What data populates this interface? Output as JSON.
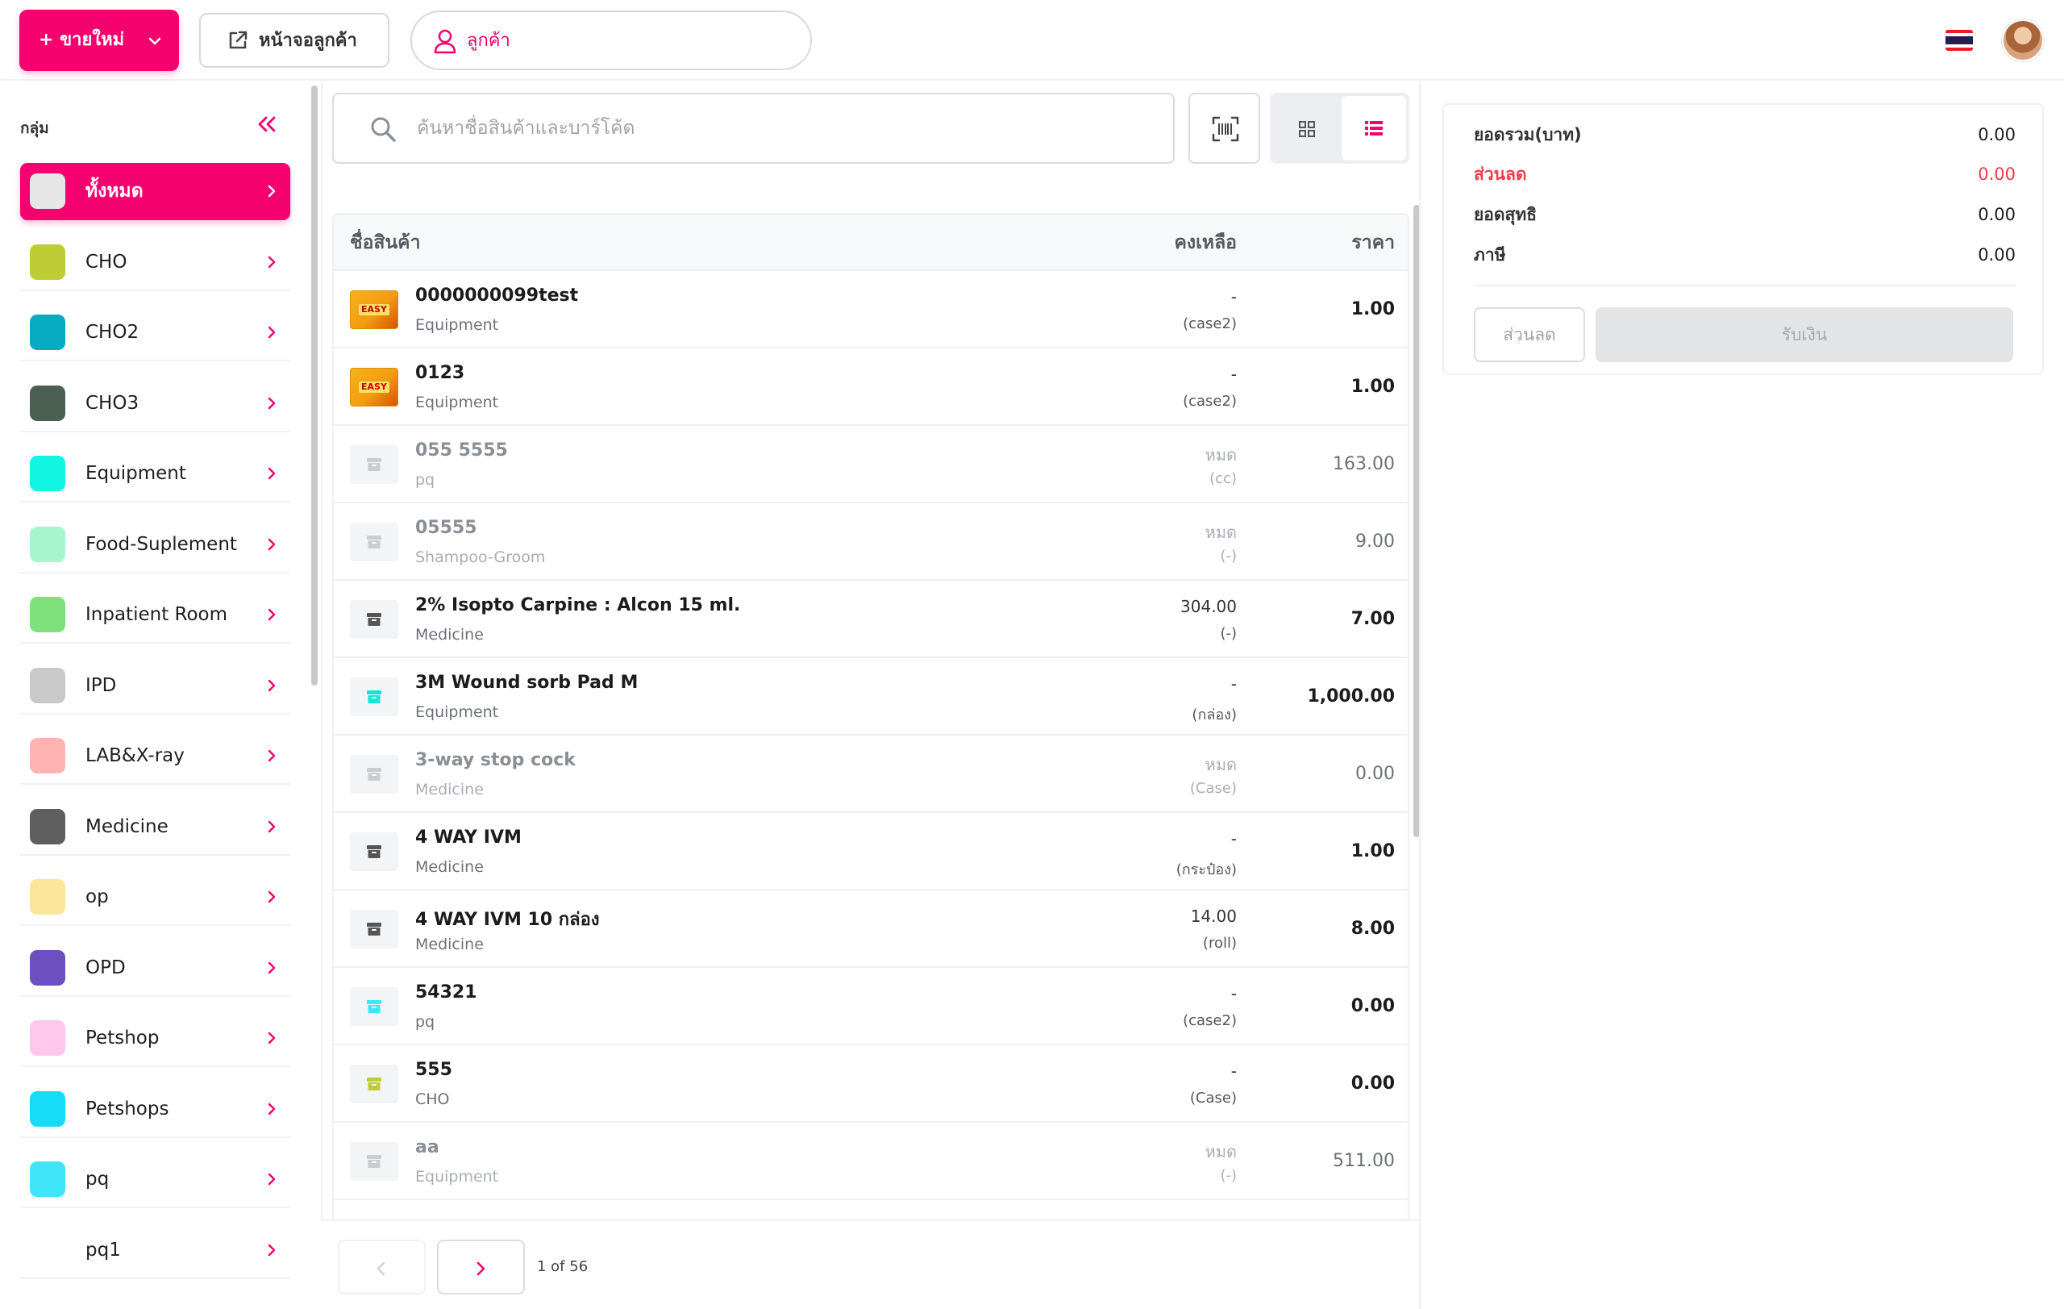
{
  "topbar": {
    "new_sale_label": "+ ขายใหม่",
    "customer_screen_label": "หน้าจอลูกค้า",
    "customer_label": "ลูกค้า",
    "flag": "thai-flag-icon",
    "colors": {
      "accent": "#f5006f",
      "discount": "#f03b4a"
    }
  },
  "sidebar": {
    "title": "กลุ่ม",
    "items": [
      {
        "label": "ทั้งหมด",
        "color": "#e6e6e6"
      },
      {
        "label": "CHO",
        "color": "#bfcc34"
      },
      {
        "label": "CHO2",
        "color": "#06abc1"
      },
      {
        "label": "CHO3",
        "color": "#4b5f53"
      },
      {
        "label": "Equipment",
        "color": "#12f7e3"
      },
      {
        "label": "Food-Suplement",
        "color": "#a8f5cb"
      },
      {
        "label": "Inpatient Room",
        "color": "#7ee17e"
      },
      {
        "label": "IPD",
        "color": "#c9c9c9"
      },
      {
        "label": "LAB&X-ray",
        "color": "#ffb3b3"
      },
      {
        "label": "Medicine",
        "color": "#5e5e5e"
      },
      {
        "label": "op",
        "color": "#fbe59a"
      },
      {
        "label": "OPD",
        "color": "#6e4fbf"
      },
      {
        "label": "Petshop",
        "color": "#ffc6ee"
      },
      {
        "label": "Petshops",
        "color": "#16dcf7"
      },
      {
        "label": "pq",
        "color": "#3ee6f7"
      },
      {
        "label": "pq1",
        "color": ""
      }
    ]
  },
  "search": {
    "placeholder": "ค้นหาชื่อสินค้าและบาร์โค้ด"
  },
  "table": {
    "headers": {
      "name": "ชื่อสินค้า",
      "stock": "คงเหลือ",
      "price": "ราคา"
    },
    "rows": [
      {
        "name": "0000000099test",
        "category": "Equipment",
        "stock": "-",
        "unit": "(case2)",
        "price": "1.00",
        "out": false,
        "thumb": "photo",
        "icon_color": ""
      },
      {
        "name": "0123",
        "category": "Equipment",
        "stock": "-",
        "unit": "(case2)",
        "price": "1.00",
        "out": false,
        "thumb": "photo",
        "icon_color": ""
      },
      {
        "name": "055 5555",
        "category": "pq",
        "stock": "หมด",
        "unit": "(cc)",
        "price": "163.00",
        "out": true,
        "thumb": "box",
        "icon_color": "#c9ccd1"
      },
      {
        "name": "05555",
        "category": "Shampoo-Groom",
        "stock": "หมด",
        "unit": "(-)",
        "price": "9.00",
        "out": true,
        "thumb": "box",
        "icon_color": "#c9ccd1"
      },
      {
        "name": "2% Isopto Carpine : Alcon 15 ml.",
        "category": "Medicine",
        "stock": "304.00",
        "unit": "(-)",
        "price": "7.00",
        "out": false,
        "thumb": "box",
        "icon_color": "#555555"
      },
      {
        "name": "3M Wound sorb Pad M",
        "category": "Equipment",
        "stock": "-",
        "unit": "(กล่อง)",
        "price": "1,000.00",
        "out": false,
        "thumb": "box",
        "icon_color": "#12e6d6"
      },
      {
        "name": "3-way stop cock",
        "category": "Medicine",
        "stock": "หมด",
        "unit": "(Case)",
        "price": "0.00",
        "out": true,
        "thumb": "box",
        "icon_color": "#c9ccd1"
      },
      {
        "name": "4 WAY IVM",
        "category": "Medicine",
        "stock": "-",
        "unit": "(กระป๋อง)",
        "price": "1.00",
        "out": false,
        "thumb": "box",
        "icon_color": "#555555"
      },
      {
        "name": "4 WAY IVM 10 กล่อง",
        "category": "Medicine",
        "stock": "14.00",
        "unit": "(roll)",
        "price": "8.00",
        "out": false,
        "thumb": "box",
        "icon_color": "#555555"
      },
      {
        "name": "54321",
        "category": "pq",
        "stock": "-",
        "unit": "(case2)",
        "price": "0.00",
        "out": false,
        "thumb": "box",
        "icon_color": "#3ee6f7"
      },
      {
        "name": "555",
        "category": "CHO",
        "stock": "-",
        "unit": "(Case)",
        "price": "0.00",
        "out": false,
        "thumb": "box",
        "icon_color": "#bfcc34"
      },
      {
        "name": "aa",
        "category": "Equipment",
        "stock": "หมด",
        "unit": "(-)",
        "price": "511.00",
        "out": true,
        "thumb": "box",
        "icon_color": "#c9ccd1"
      }
    ]
  },
  "pager": {
    "info": "1 of 56"
  },
  "summary": {
    "total_label": "ยอดรวม(บาท)",
    "total_value": "0.00",
    "discount_label": "ส่วนลด",
    "discount_value": "0.00",
    "net_label": "ยอดสุทธิ",
    "net_value": "0.00",
    "tax_label": "ภาษี",
    "tax_value": "0.00",
    "discount_button": "ส่วนลด",
    "pay_button": "รับเงิน"
  }
}
